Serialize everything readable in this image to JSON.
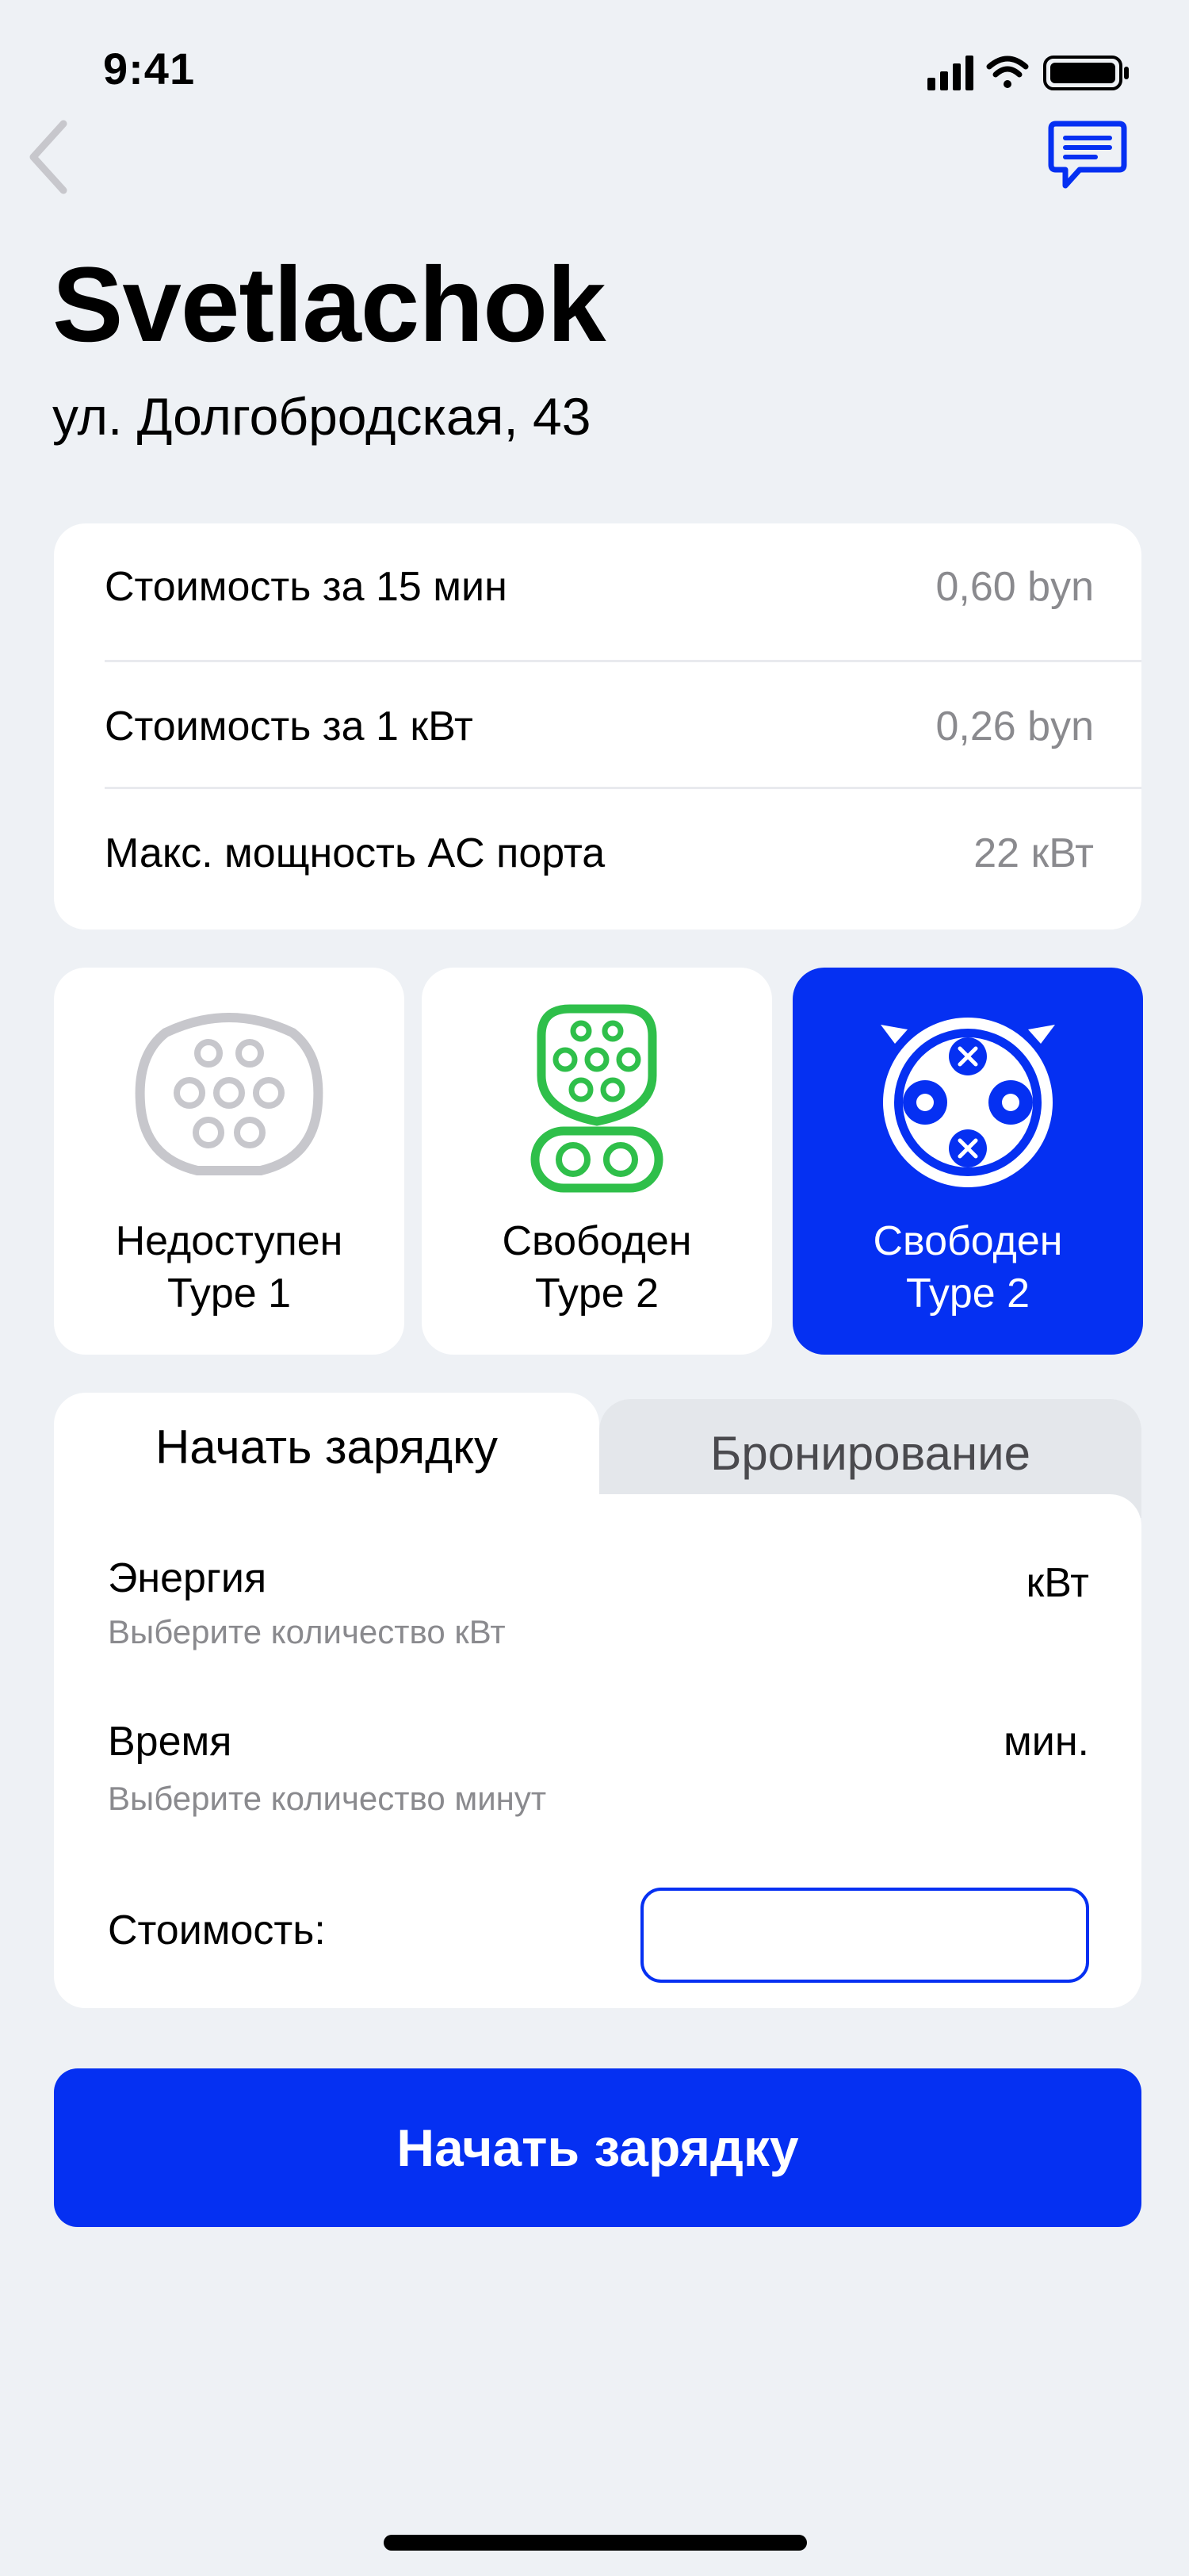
{
  "status_bar": {
    "time": "9:41"
  },
  "header": {
    "back_icon": "chevron-left-icon",
    "chat_icon": "chat-bubble-icon"
  },
  "station": {
    "name": "Svetlachok",
    "address": "ул. Долгобродская, 43"
  },
  "info": [
    {
      "label": "Стоимость за 15 мин",
      "value": "0,60 byn"
    },
    {
      "label": "Стоимость за 1 кВт",
      "value": "0,26 byn"
    },
    {
      "label": "Макс. мощность AC порта",
      "value": "22 кВт"
    }
  ],
  "connectors": [
    {
      "status": "Недоступен",
      "type": "Type 1",
      "icon": "type1-connector-icon",
      "color": "#C7C7CC"
    },
    {
      "status": "Свободен",
      "type": "Type 2",
      "icon": "ccs-combo-connector-icon",
      "color": "#2FBF4A"
    },
    {
      "status": "Свободен",
      "type": "Type 2",
      "icon": "chademo-connector-icon",
      "color": "#FFFFFF"
    }
  ],
  "tabs": [
    {
      "label": "Начать зарядку"
    },
    {
      "label": "Бронирование"
    }
  ],
  "form": {
    "energy": {
      "label": "Энергия",
      "hint": "Выберите количество кВт",
      "unit": "кВт"
    },
    "time": {
      "label": "Время",
      "hint": "Выберите количество минут",
      "unit": "мин."
    },
    "cost": {
      "label": "Стоимость:",
      "value": ""
    }
  },
  "cta": {
    "label": "Начать зарядку"
  },
  "colors": {
    "accent": "#0530F2",
    "available": "#2FBF4A",
    "unavailable": "#C7C7CC",
    "background": "#EEF1F5"
  }
}
